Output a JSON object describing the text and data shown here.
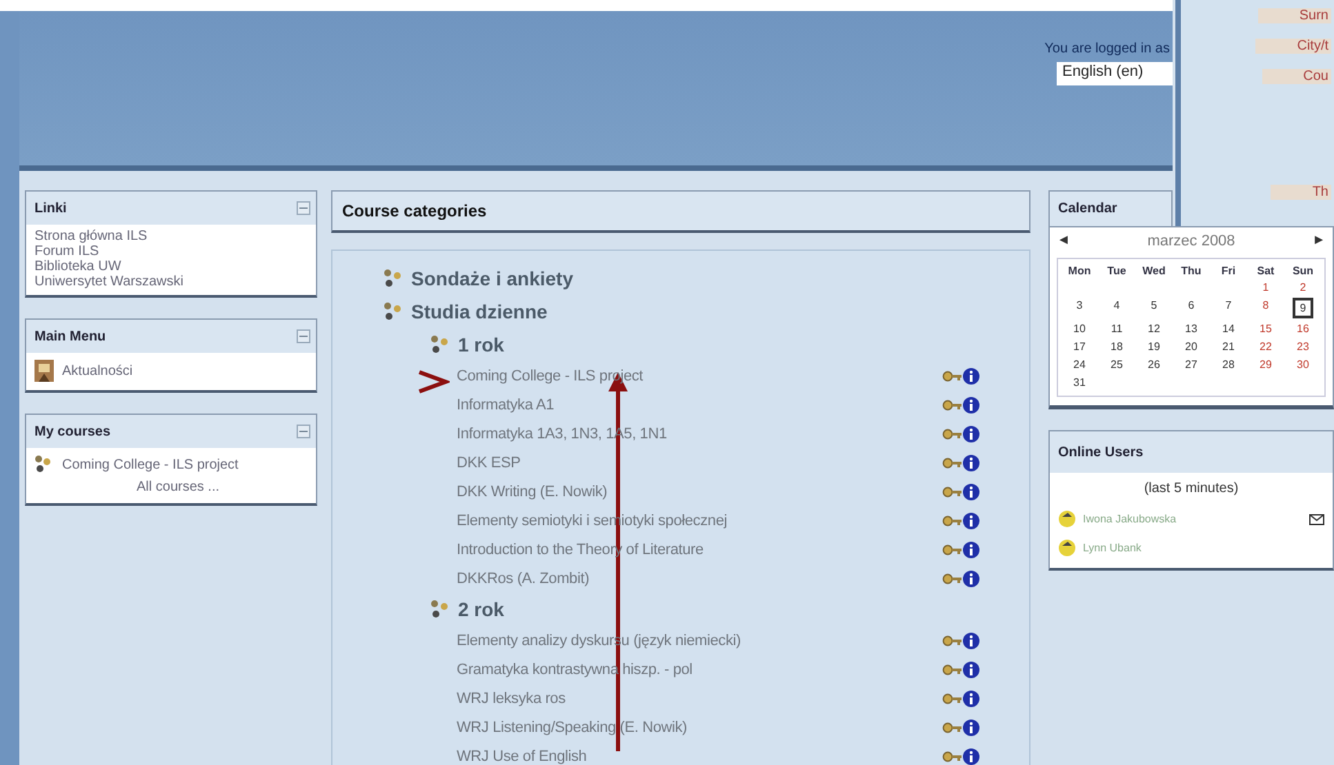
{
  "header": {
    "login_text": "You are logged in as",
    "language": "English (en)"
  },
  "side_window": {
    "labels": [
      "Surn",
      "City/t",
      "Cou",
      "Th"
    ]
  },
  "left_blocks": [
    {
      "kind": "links",
      "title": "Linki",
      "items": [
        "Strona główna ILS",
        "Forum ILS",
        "Biblioteka UW",
        "Uniwersytet Warszawski"
      ]
    },
    {
      "kind": "menu",
      "title": "Main Menu",
      "items": [
        "Aktualności"
      ]
    },
    {
      "kind": "courses",
      "title": "My courses",
      "items": [
        "Coming College - ILS project"
      ],
      "footer": "All courses ..."
    }
  ],
  "course_categories": {
    "title": "Course categories",
    "children": [
      {
        "name": "Sondaże i ankiety"
      },
      {
        "name": "Studia dzienne",
        "children": [
          {
            "name": "1 rok",
            "courses": [
              "Coming College - ILS project",
              "Informatyka A1",
              "Informatyka 1A3, 1N3, 1A5, 1N1",
              "DKK ESP",
              "DKK Writing (E. Nowik)",
              "Elementy semiotyki i semiotyki społecznej",
              "Introduction to the Theory of Literature",
              "DKKRos (A. Zombit)"
            ]
          },
          {
            "name": "2 rok",
            "courses": [
              "Elementy analizy dyskursu (język niemiecki)",
              "Gramatyka kontrastywna hiszp. - pol",
              "WRJ leksyka ros",
              "WRJ Listening/Speaking (E. Nowik)",
              "WRJ Use of English"
            ]
          }
        ]
      }
    ]
  },
  "calendar": {
    "title": "Calendar",
    "prev": "◄",
    "month": "marzec 2008",
    "next": "►",
    "weekdays": [
      "Mon",
      "Tue",
      "Wed",
      "Thu",
      "Fri",
      "Sat",
      "Sun"
    ],
    "days": [
      {
        "day": "1",
        "weekend": true,
        "today": false
      },
      {
        "day": "2",
        "weekend": true,
        "today": false
      },
      {
        "day": "3",
        "weekend": false,
        "today": false
      },
      {
        "day": "4",
        "weekend": false,
        "today": false
      },
      {
        "day": "5",
        "weekend": false,
        "today": false
      },
      {
        "day": "6",
        "weekend": false,
        "today": false
      },
      {
        "day": "7",
        "weekend": false,
        "today": false
      },
      {
        "day": "8",
        "weekend": true,
        "today": false
      },
      {
        "day": "9",
        "weekend": true,
        "today": true
      },
      {
        "day": "10",
        "weekend": false,
        "today": false
      },
      {
        "day": "11",
        "weekend": false,
        "today": false
      },
      {
        "day": "12",
        "weekend": false,
        "today": false
      },
      {
        "day": "13",
        "weekend": false,
        "today": false
      },
      {
        "day": "14",
        "weekend": false,
        "today": false
      },
      {
        "day": "15",
        "weekend": true,
        "today": false
      },
      {
        "day": "16",
        "weekend": true,
        "today": false
      },
      {
        "day": "17",
        "weekend": false,
        "today": false
      },
      {
        "day": "18",
        "weekend": false,
        "today": false
      },
      {
        "day": "19",
        "weekend": false,
        "today": false
      },
      {
        "day": "20",
        "weekend": false,
        "today": false
      },
      {
        "day": "21",
        "weekend": false,
        "today": false
      },
      {
        "day": "22",
        "weekend": true,
        "today": false
      },
      {
        "day": "23",
        "weekend": true,
        "today": false
      },
      {
        "day": "24",
        "weekend": false,
        "today": false
      },
      {
        "day": "25",
        "weekend": false,
        "today": false
      },
      {
        "day": "26",
        "weekend": false,
        "today": false
      },
      {
        "day": "27",
        "weekend": false,
        "today": false
      },
      {
        "day": "28",
        "weekend": false,
        "today": false
      },
      {
        "day": "29",
        "weekend": true,
        "today": false
      },
      {
        "day": "30",
        "weekend": true,
        "today": false
      },
      {
        "day": "31",
        "weekend": false,
        "today": false
      }
    ]
  },
  "online_users": {
    "title": "Online Users",
    "note": "(last 5 minutes)",
    "users": [
      {
        "name": "Iwona Jakubowska",
        "message": true
      },
      {
        "name": "Lynn Ubank"
      }
    ]
  }
}
